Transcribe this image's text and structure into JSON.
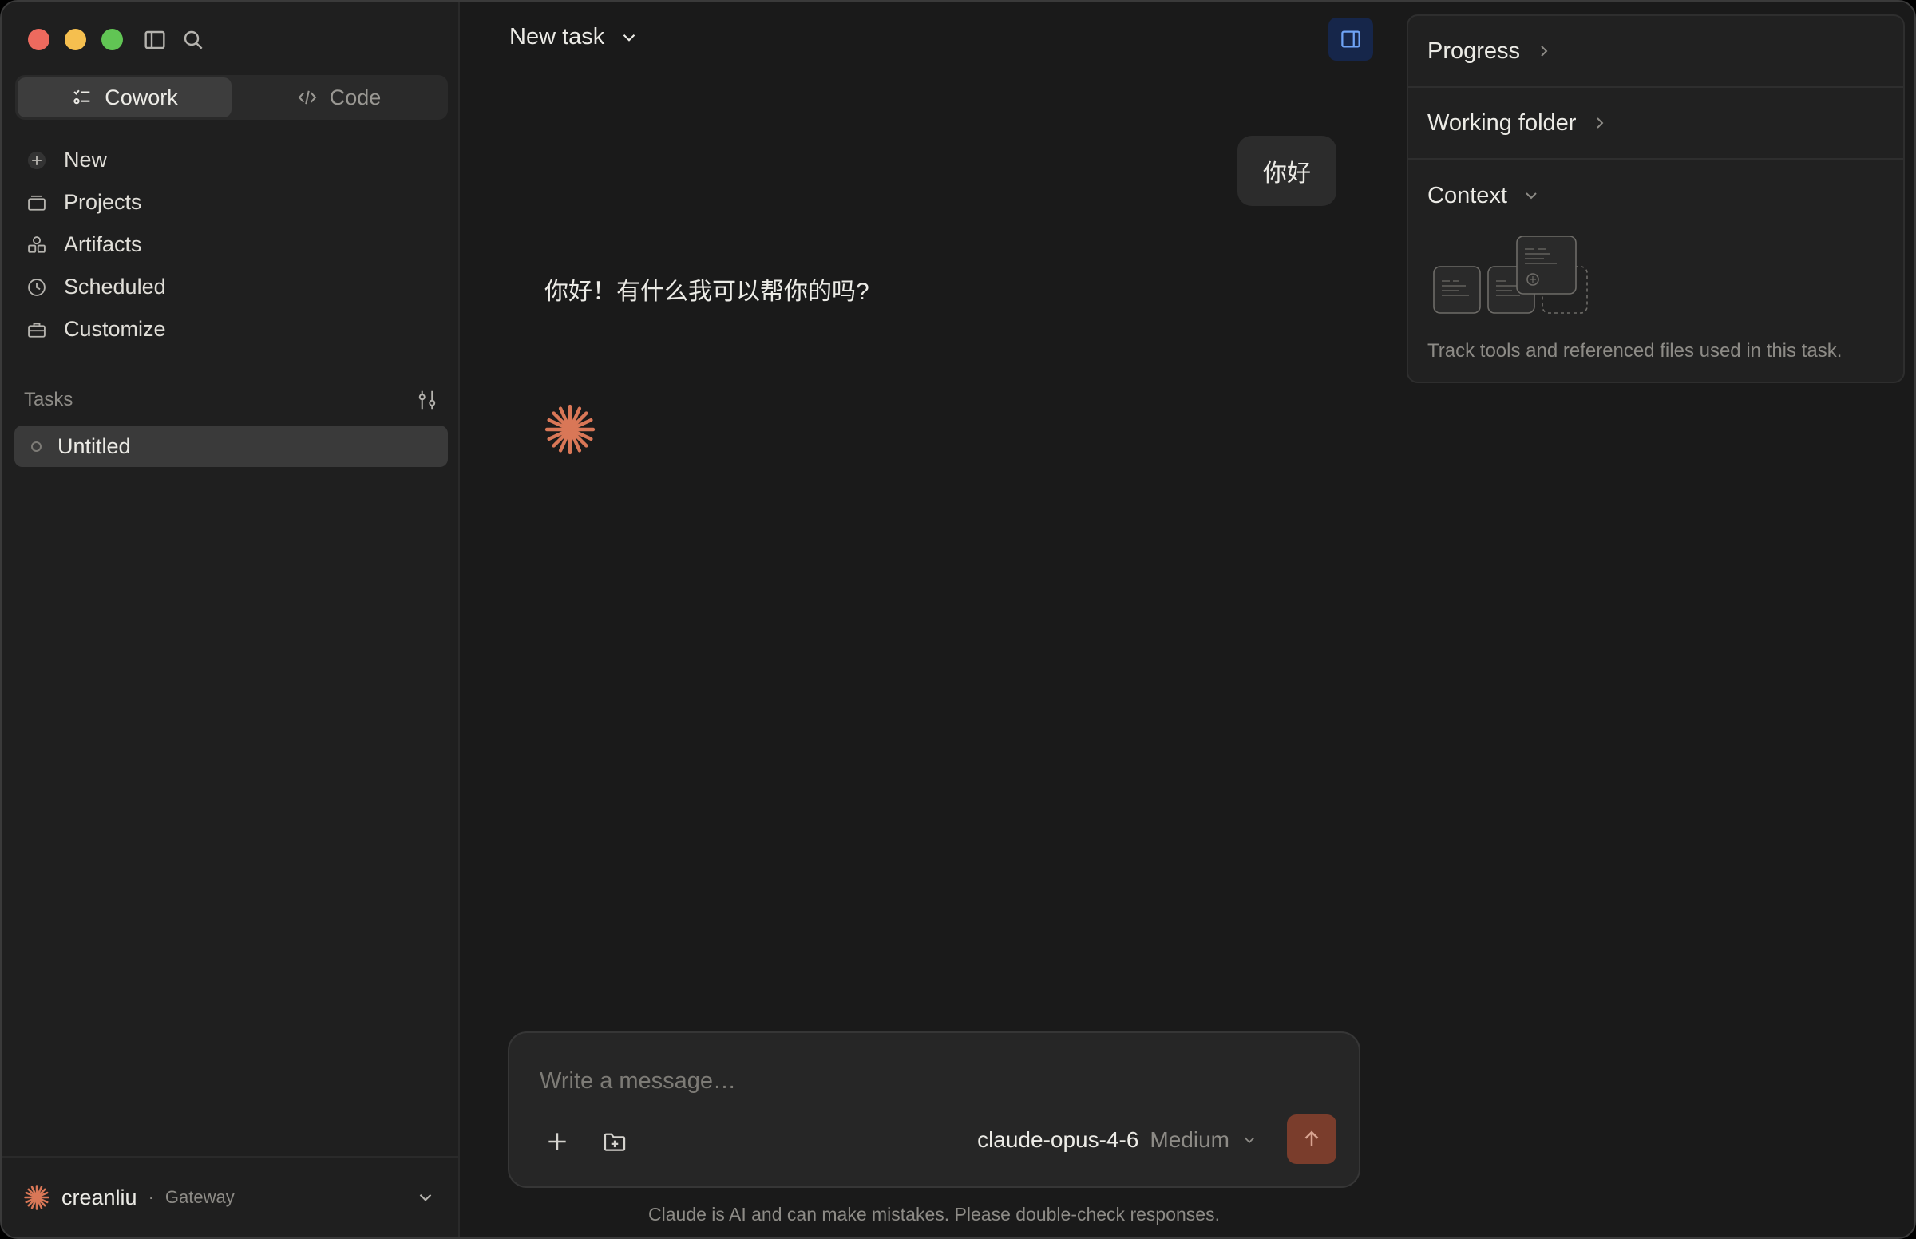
{
  "sidebar": {
    "mode_tabs": [
      {
        "label": "Cowork",
        "active": true
      },
      {
        "label": "Code",
        "active": false
      }
    ],
    "nav": [
      {
        "label": "New",
        "icon": "plus-circle-icon"
      },
      {
        "label": "Projects",
        "icon": "folder-icon"
      },
      {
        "label": "Artifacts",
        "icon": "shapes-icon"
      },
      {
        "label": "Scheduled",
        "icon": "clock-icon"
      },
      {
        "label": "Customize",
        "icon": "briefcase-icon"
      }
    ],
    "tasks_label": "Tasks",
    "tasks": [
      {
        "label": "Untitled"
      }
    ],
    "user": {
      "name": "creanliu",
      "sub": "Gateway"
    }
  },
  "main": {
    "title": "New task",
    "user_message": "你好",
    "assistant_message": "你好！有什么我可以帮你的吗?",
    "composer": {
      "placeholder": "Write a message…",
      "model": "claude-opus-4-6",
      "effort": "Medium"
    },
    "disclaimer": "Claude is AI and can make mistakes. Please double-check responses."
  },
  "right_panel": {
    "sections": [
      {
        "label": "Progress",
        "state": "collapsed"
      },
      {
        "label": "Working folder",
        "state": "collapsed"
      },
      {
        "label": "Context",
        "state": "expanded"
      }
    ],
    "context_description": "Track tools and referenced files used in this task."
  },
  "colors": {
    "accent": "#d97757",
    "send_button": "#7a3d2c",
    "panel_toggle": "#16264a"
  }
}
